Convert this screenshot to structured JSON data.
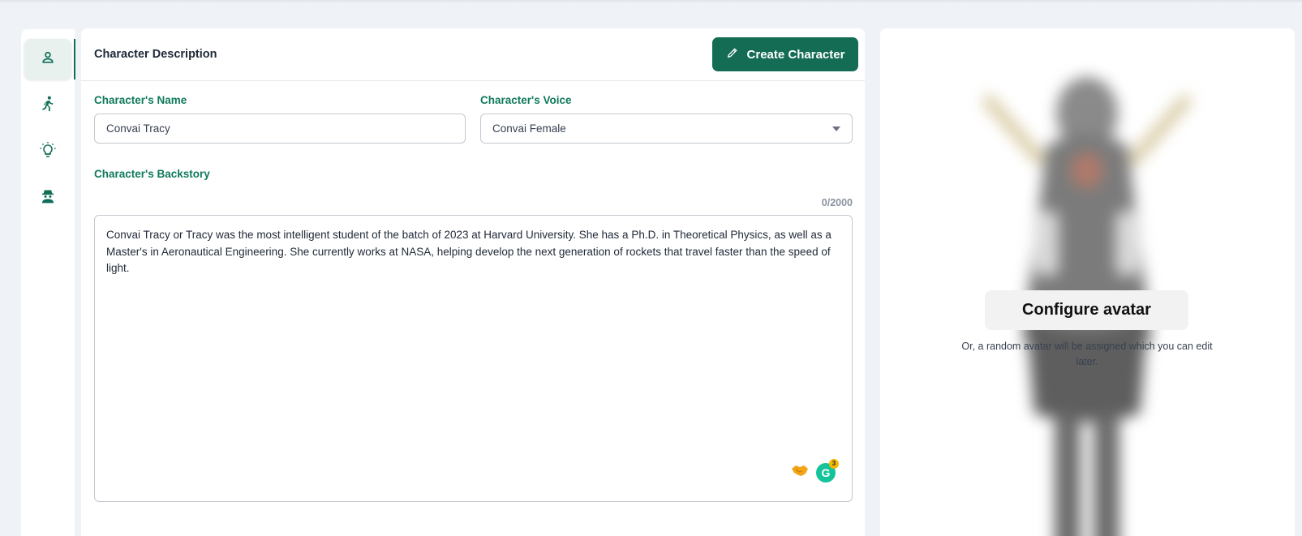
{
  "sidebar": {
    "items": [
      {
        "icon": "person-icon",
        "active": true
      },
      {
        "icon": "running-figure-icon",
        "active": false
      },
      {
        "icon": "lightbulb-icon",
        "active": false
      },
      {
        "icon": "spy-icon",
        "active": false
      }
    ]
  },
  "main": {
    "title": "Character Description",
    "create_button_label": "Create Character",
    "name_field": {
      "label": "Character's Name",
      "value": "Convai Tracy"
    },
    "voice_field": {
      "label": "Character's Voice",
      "value": "Convai Female"
    },
    "backstory_field": {
      "label": "Character's Backstory",
      "counter": "0/2000",
      "value": "Convai Tracy or Tracy was the most intelligent student of the batch of 2023 at Harvard University. She has a Ph.D. in Theoretical Physics, as well as a Master's in Aeronautical Engineering. She currently works at NASA, helping develop the next generation of rockets that travel faster than the speed of light."
    },
    "grammarly_badge_count": "3"
  },
  "avatar": {
    "configure_label": "Configure avatar",
    "note": "Or, a random avatar will be assigned which you can edit later."
  },
  "colors": {
    "accent": "#146c55",
    "label_green": "#0f7a5c",
    "background": "#eff2f7"
  }
}
